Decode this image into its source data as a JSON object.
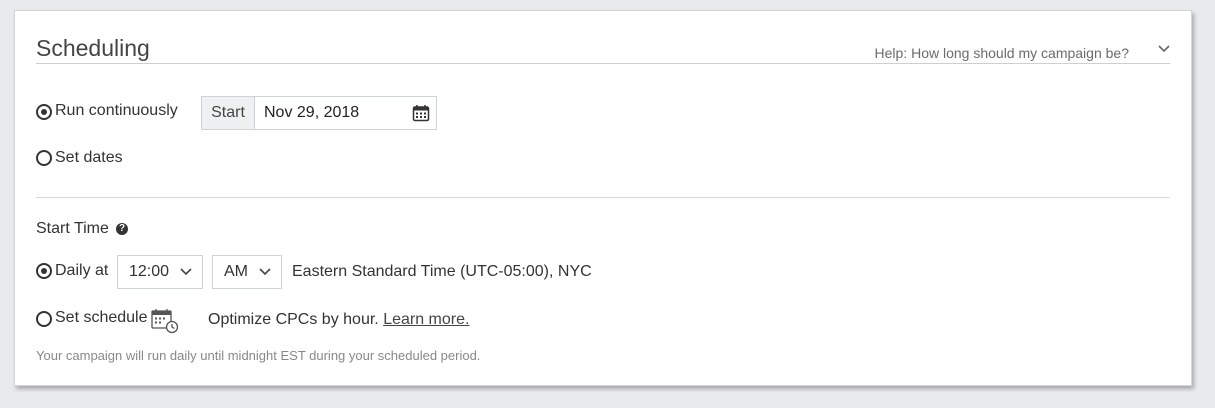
{
  "section": {
    "title": "Scheduling",
    "help_text": "Help: How long should my campaign be?"
  },
  "duration": {
    "run_continuously_label": "Run continuously",
    "set_dates_label": "Set dates",
    "start_addon": "Start",
    "start_date": "Nov 29, 2018",
    "selected": "run_continuously"
  },
  "start_time": {
    "heading": "Start Time",
    "help_glyph": "?",
    "daily_at_label": "Daily at",
    "time_value": "12:00",
    "ampm_value": "AM",
    "timezone": "Eastern Standard Time (UTC-05:00), NYC",
    "set_schedule_label": "Set schedule",
    "optimize_text": "Optimize CPCs by hour.",
    "learn_more": "Learn more.",
    "selected": "daily_at"
  },
  "footer_note": "Your campaign will run daily until midnight EST during your scheduled period.",
  "icons": [
    "chevron-down-icon",
    "calendar-icon",
    "help-circle-icon",
    "schedule-calendar-icon"
  ]
}
